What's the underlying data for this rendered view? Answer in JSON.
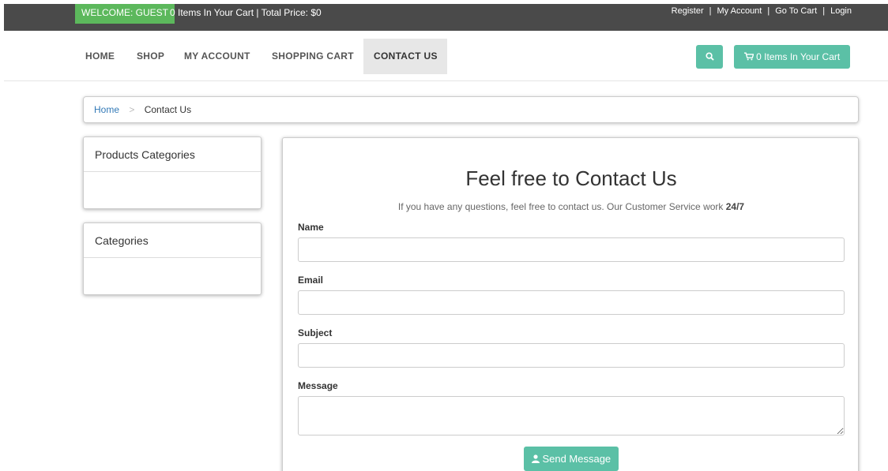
{
  "topbar": {
    "welcome": "WELCOME: GUEST",
    "cart_summary": "0 Items In Your Cart | Total Price: $0",
    "links": [
      "Register",
      "My Account",
      "Go To Cart",
      "Login"
    ],
    "separator": "|"
  },
  "nav": {
    "items": [
      "HOME",
      "SHOP",
      "MY ACCOUNT",
      "SHOPPING CART",
      "CONTACT US"
    ],
    "active": "CONTACT US",
    "cart_button": "0 Items In Your Cart"
  },
  "breadcrumb": {
    "home": "Home",
    "separator": ">",
    "current": "Contact Us"
  },
  "sidebar": {
    "panels": [
      {
        "title": "Products Categories"
      },
      {
        "title": "Categories"
      }
    ]
  },
  "contact": {
    "title": "Feel free to Contact Us",
    "subtitle": "If you have any questions, feel free to contact us. Our Customer Service work ",
    "subtitle_bold": "24/7",
    "name_label": "Name",
    "email_label": "Email",
    "subject_label": "Subject",
    "message_label": "Message",
    "send_label": "Send Message"
  },
  "colors": {
    "topbar": "#4a4a4a",
    "welcome": "#5cb85c",
    "accent": "#5bc0a6",
    "link": "#337ab7"
  },
  "icons": {
    "search": "search-icon",
    "cart": "shopping-cart-icon",
    "send": "user-icon"
  }
}
